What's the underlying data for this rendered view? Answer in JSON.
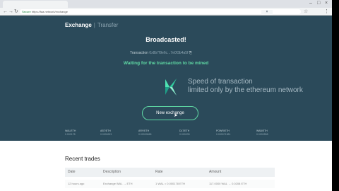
{
  "browser": {
    "tab_title": "",
    "url_secure_label": "Secure",
    "url_text": "https://faa.network/exchange"
  },
  "exchange": {
    "tab_exchange": "Exchange",
    "tab_transfer": "Transfer",
    "close_label": "×",
    "status": "Broadcasted!",
    "transaction_label": "Transaction",
    "transaction_hash": "0x8b7f9e6c...7e0f3b4a5f",
    "waiting": "Waiting for the transaction to be mined",
    "speed_line1": "Speed of transaction",
    "speed_line2": "limited only by the ethereum network",
    "new_exchange_label": "New exchange",
    "stats": [
      {
        "label": "WAL/ETH",
        "value": "0.000178"
      },
      {
        "label": "ABT/ETH",
        "value": "0.0006921"
      },
      {
        "label": "ARY/ETH",
        "value": "0.00000665"
      },
      {
        "label": "DLT/ETH",
        "value": "0.000033"
      },
      {
        "label": "POWR/ETH",
        "value": "0.000071981"
      },
      {
        "label": "WAB/ETH",
        "value": "0.0000558"
      }
    ]
  },
  "trades": {
    "title": "Recent trades",
    "columns": [
      "Date",
      "Description",
      "Rate",
      "Amount"
    ],
    "rows": [
      {
        "date": "12 hours ago",
        "description": "Exchange WAL → ETH",
        "rate": "1 WAL = 0.000178 ETH",
        "amount": "117.0000 WAL → 0.0208 ETH"
      }
    ]
  }
}
